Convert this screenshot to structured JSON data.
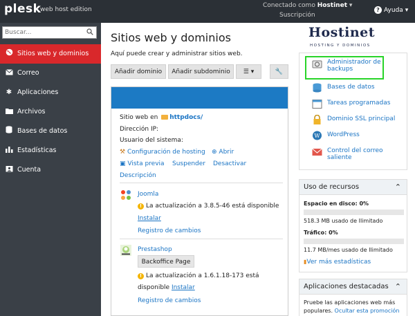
{
  "topbar": {
    "logo": "plesk",
    "edition": "web host edition",
    "connected_prefix": "Conectado como",
    "user": "Hostinet",
    "subscription": "Suscripción",
    "help": "Ayuda"
  },
  "sidebar": {
    "search_placeholder": "Buscar...",
    "items": [
      {
        "label": "Sitios web y dominios",
        "icon": "globe-icon"
      },
      {
        "label": "Correo",
        "icon": "mail-icon"
      },
      {
        "label": "Aplicaciones",
        "icon": "gear-icon"
      },
      {
        "label": "Archivos",
        "icon": "folder-icon"
      },
      {
        "label": "Bases de datos",
        "icon": "database-icon"
      },
      {
        "label": "Estadísticas",
        "icon": "bar-chart-icon"
      },
      {
        "label": "Cuenta",
        "icon": "account-icon"
      }
    ]
  },
  "main": {
    "title": "Sitios web y dominios",
    "subtitle": "Aquí puede crear y administrar sitios web.",
    "buttons": {
      "add_domain": "Añadir dominio",
      "add_subdomain": "Añadir subdominio"
    },
    "site": {
      "website_label": "Sitio web en",
      "folder": "httpdocs/",
      "ip_label": "Dirección IP:",
      "user_label": "Usuario del sistema:",
      "hosting_config": "Configuración de hosting",
      "open": "Abrir",
      "preview": "Vista previa",
      "suspend": "Suspender",
      "deactivate": "Desactivar",
      "description": "Descripción"
    },
    "joomla": {
      "name": "Joomla",
      "update": "La actualización a 3.8.5-46 está disponible",
      "install": "Instalar",
      "changelog": "Registro de cambios"
    },
    "prestashop": {
      "name": "Prestashop",
      "backoffice": "Backoffice Page",
      "update_line1": "La actualización a 1.6.1.18-173 está",
      "update_line2": "disponible",
      "install": "Instalar",
      "changelog": "Registro de cambios"
    }
  },
  "right": {
    "logo": {
      "name": "Hostinet",
      "tagline": "HOSTING Y DOMINIOS"
    },
    "links": [
      {
        "label_1": "Administrador de",
        "label_2": "backups"
      },
      {
        "label_1": "Bases de datos"
      },
      {
        "label_1": "Tareas programadas"
      },
      {
        "label_1": "Dominio SSL principal"
      },
      {
        "label_1": "WordPress"
      },
      {
        "label_1": "Control del correo",
        "label_2": "saliente"
      }
    ],
    "resources": {
      "title": "Uso de recursos",
      "disk_label": "Espacio en disco: 0%",
      "disk_value": "518.3 MB usado de Ilimitado",
      "traffic_label": "Tráfico: 0%",
      "traffic_value": "11.7 MB/mes usado de Ilimitado",
      "more_stats": "Ver más estadísticas"
    },
    "featured": {
      "title": "Aplicaciones destacadas",
      "text": "Pruebe las aplicaciones web más",
      "text2": "populares.",
      "hide": "Ocultar esta promoción"
    }
  }
}
